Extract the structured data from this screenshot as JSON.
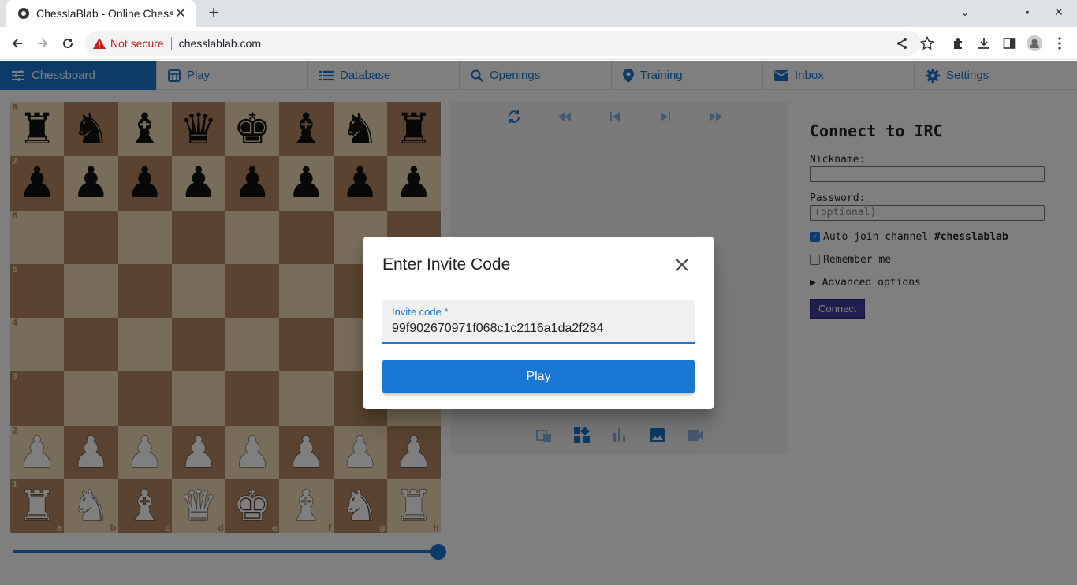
{
  "browser": {
    "tab_title": "ChesslaBlab - Online Chess",
    "security_label": "Not secure",
    "url": "chesslablab.com"
  },
  "nav": {
    "items": [
      {
        "label": "Chessboard",
        "icon": "tune-icon"
      },
      {
        "label": "Play",
        "icon": "calendar-grid-icon"
      },
      {
        "label": "Database",
        "icon": "list-icon"
      },
      {
        "label": "Openings",
        "icon": "search-icon"
      },
      {
        "label": "Training",
        "icon": "location-pin-icon"
      },
      {
        "label": "Inbox",
        "icon": "mail-icon"
      },
      {
        "label": "Settings",
        "icon": "gear-icon"
      }
    ]
  },
  "board": {
    "ranks": [
      "8",
      "7",
      "6",
      "5",
      "4",
      "3",
      "2",
      "1"
    ],
    "files": [
      "a",
      "b",
      "c",
      "d",
      "e",
      "f",
      "g",
      "h"
    ],
    "pieces": [
      [
        "♜",
        "♞",
        "♝",
        "♛",
        "♚",
        "♝",
        "♞",
        "♜"
      ],
      [
        "♟",
        "♟",
        "♟",
        "♟",
        "♟",
        "♟",
        "♟",
        "♟"
      ],
      [
        "",
        "",
        "",
        "",
        "",
        "",
        "",
        ""
      ],
      [
        "",
        "",
        "",
        "",
        "",
        "",
        "",
        ""
      ],
      [
        "",
        "",
        "",
        "",
        "",
        "",
        "",
        ""
      ],
      [
        "",
        "",
        "",
        "",
        "",
        "",
        "",
        ""
      ],
      [
        "♟",
        "♟",
        "♟",
        "♟",
        "♟",
        "♟",
        "♟",
        "♟"
      ],
      [
        "♜",
        "♞",
        "♝",
        "♛",
        "♚",
        "♝",
        "♞",
        "♜"
      ]
    ],
    "colors": [
      "b",
      "b",
      "",
      "",
      "",
      "",
      "w",
      "w"
    ],
    "light_color": "#f0d9b5",
    "dark_color": "#b58863"
  },
  "history_slider": {
    "position_fraction": 1.0
  },
  "irc": {
    "title": "Connect to IRC",
    "nickname_label": "Nickname:",
    "nickname_value": "",
    "password_label": "Password:",
    "password_placeholder": "(optional)",
    "autojoin_prefix": "Auto-join channel ",
    "autojoin_channel": "#chesslablab",
    "autojoin_checked": true,
    "remember_label": "Remember me",
    "remember_checked": false,
    "advanced_label": "Advanced options",
    "connect_label": "Connect"
  },
  "dialog": {
    "title": "Enter Invite Code",
    "field_label": "Invite code *",
    "field_value": "99f902670971f068c1c2116a1da2f284",
    "play_label": "Play"
  },
  "colors": {
    "accent": "#1976d2"
  }
}
